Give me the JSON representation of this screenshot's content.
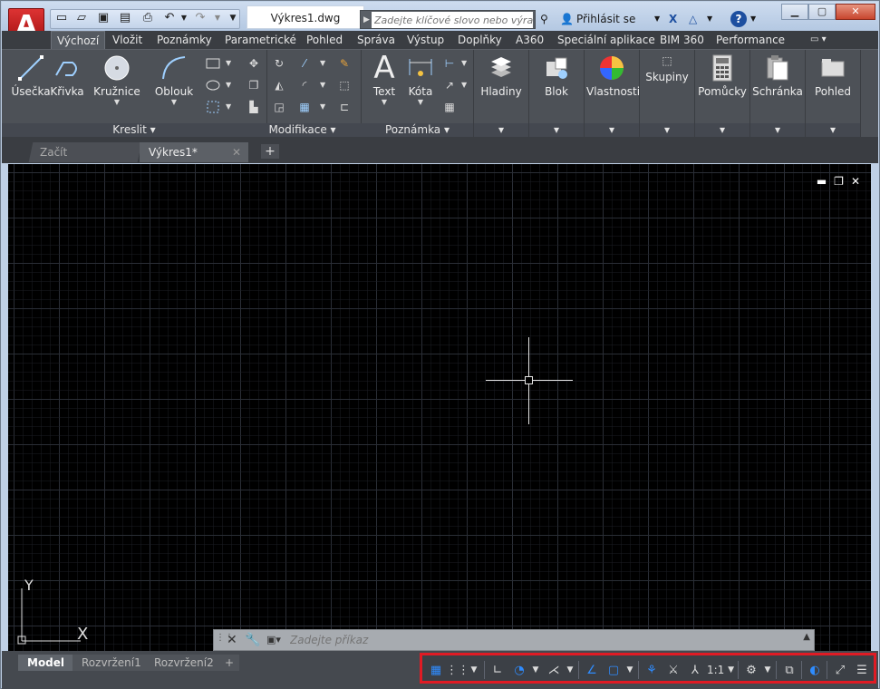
{
  "window": {
    "title": "Výkres1.dwg"
  },
  "search": {
    "placeholder": "Zadejte klíčové slovo nebo výraz"
  },
  "account": {
    "sign_in": "Přihlásit se"
  },
  "ribbon_tabs": [
    "Výchozí",
    "Vložit",
    "Poznámky",
    "Parametrické",
    "Pohled",
    "Správa",
    "Výstup",
    "Doplňky",
    "A360",
    "Speciální aplikace",
    "BIM 360",
    "Performance"
  ],
  "panels": {
    "draw": {
      "footer": "Kreslit",
      "tools": [
        "Úsečka",
        "Křivka",
        "Kružnice",
        "Oblouk"
      ]
    },
    "modify": {
      "footer": "Modifikace"
    },
    "annotation": {
      "footer": "Poznámka",
      "tools": [
        "Text",
        "Kóta"
      ]
    },
    "big": [
      "Hladiny",
      "Blok",
      "Vlastnosti",
      "Skupiny",
      "Pomůcky",
      "Schránka",
      "Pohled"
    ]
  },
  "doc_tabs": {
    "start": "Začít",
    "drawing": "Výkres1*"
  },
  "command": {
    "placeholder": "Zadejte příkaz"
  },
  "layout_tabs": {
    "model": "Model",
    "layout1": "Rozvržení1",
    "layout2": "Rozvržení2"
  },
  "status": {
    "scale": "1:1"
  },
  "ucs": {
    "x": "X",
    "y": "Y"
  },
  "colors": {
    "canvas": "#000000",
    "ribbon": "#4d5157",
    "status_highlight": "#e01b24",
    "accent_blue": "#2f8cff"
  }
}
